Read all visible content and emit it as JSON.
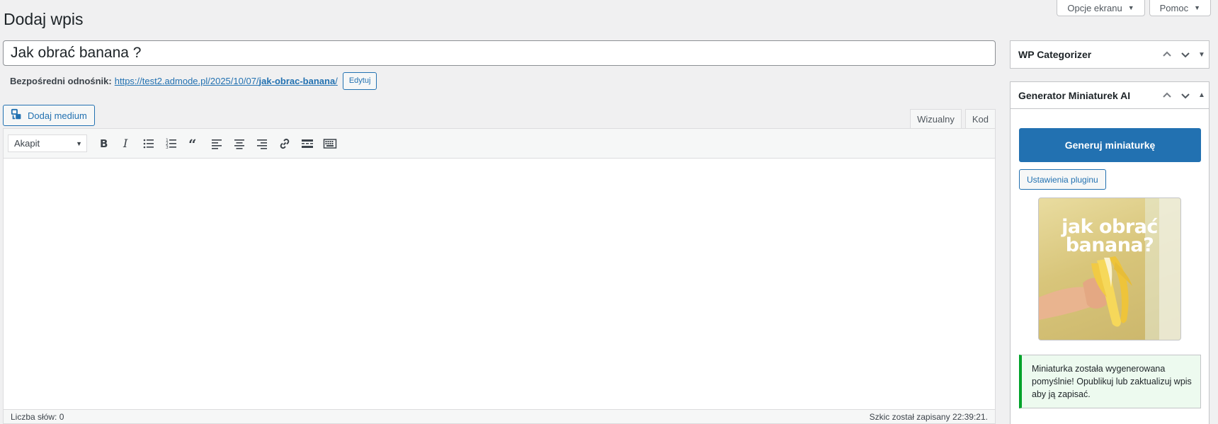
{
  "screen_options": {
    "label": "Opcje ekranu"
  },
  "help": {
    "label": "Pomoc"
  },
  "page": {
    "title": "Dodaj wpis"
  },
  "post": {
    "title_value": "Jak obrać banana ?"
  },
  "permalink": {
    "label": "Bezpośredni odnośnik:",
    "url_base": "https://test2.admode.pl/2025/10/07/",
    "slug": "jak-obrac-banana",
    "url_tail": "/",
    "edit_label": "Edytuj"
  },
  "media": {
    "add_label": "Dodaj medium"
  },
  "editor": {
    "tabs": {
      "visual": "Wizualny",
      "code": "Kod"
    },
    "format_select": "Akapit",
    "toolbar_icons": [
      "bold-icon",
      "italic-icon",
      "bullet-list-icon",
      "numbered-list-icon",
      "blockquote-icon",
      "align-left-icon",
      "align-center-icon",
      "align-right-icon",
      "link-icon",
      "read-more-icon",
      "toolbar-toggle-icon"
    ],
    "word_count": "Liczba słów: 0",
    "draft_status": "Szkic został zapisany 22:39:21."
  },
  "sidebar": {
    "categorizer": {
      "title": "WP Categorizer"
    },
    "thumbnail_generator": {
      "title": "Generator Miniaturek AI",
      "generate_label": "Generuj miniaturkę",
      "settings_label": "Ustawienia pluginu",
      "thumbnail_text": "jak obrać banana?",
      "notice": "Miniaturka została wygenerowana pomyślnie! Opublikuj lub zaktualizuj wpis aby ją zapisać."
    }
  },
  "colors": {
    "accent": "#2271b1",
    "success": "#00a32a",
    "background": "#f0f0f1"
  }
}
